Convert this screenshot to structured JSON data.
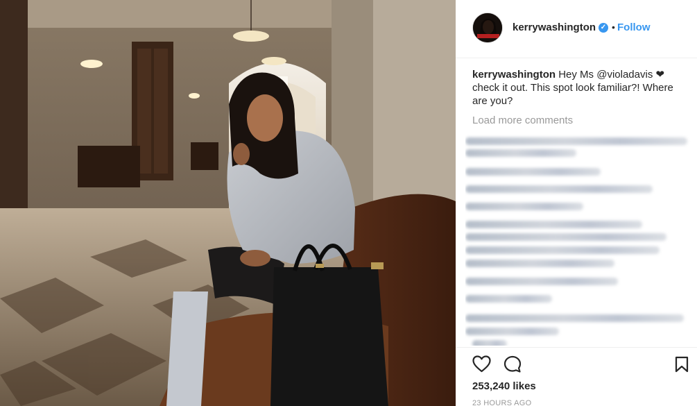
{
  "post": {
    "image_alt": "",
    "author": {
      "username": "kerrywashington",
      "verified": true,
      "separator": "•",
      "follow_label": "Follow"
    },
    "caption": {
      "username": "kerrywashington",
      "text_before": "Hey Ms ",
      "mention": "@violadavis",
      "text_after": " ❤ check it out. This spot look familiar?! Where are you?"
    },
    "load_more_label": "Load more comments",
    "comments_blurred": true,
    "actions": {
      "like_icon": "heart-outline-icon",
      "comment_icon": "speech-bubble-icon",
      "save_icon": "bookmark-icon"
    },
    "likes_text": "253,240 likes",
    "timestamp": "23 HOURS AGO"
  },
  "colors": {
    "link": "#3897f0",
    "text": "#262626",
    "muted": "#999999",
    "divider": "#efefef"
  }
}
